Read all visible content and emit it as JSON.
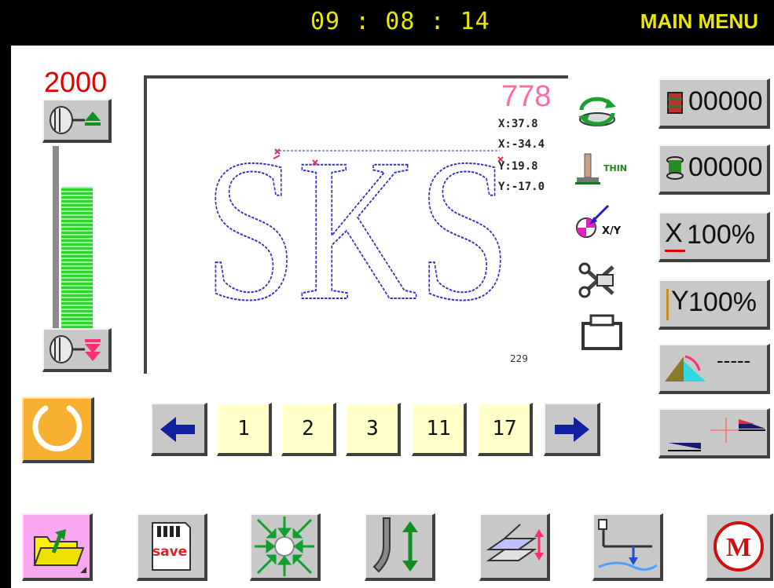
{
  "header": {
    "time": "09 : 08 : 14",
    "title": "MAIN MENU"
  },
  "speed": {
    "value": "2000",
    "level": 0.75
  },
  "pattern": {
    "text": "SKS",
    "stitch_count": "778",
    "coords": [
      "X:37.8",
      "X:-34.4",
      "Y:19.8",
      "Y:-17.0"
    ],
    "position": "229"
  },
  "counters": {
    "production": "00000",
    "bobbin": "00000",
    "x_scale": "100%",
    "y_scale": "100%",
    "angle": "-----"
  },
  "pages": {
    "items": [
      "1",
      "2",
      "3",
      "11",
      "17"
    ]
  },
  "thin_label": "THIN",
  "xy_label": "X/Y",
  "save_label": "save",
  "m_label": "M",
  "x_letter": "X",
  "y_letter": "Y",
  "colors": {
    "accent_orange": "#f8b030",
    "clock_yellow": "#e8e800",
    "speed_red": "#e00000",
    "stitch_blue": "#3030c0"
  }
}
